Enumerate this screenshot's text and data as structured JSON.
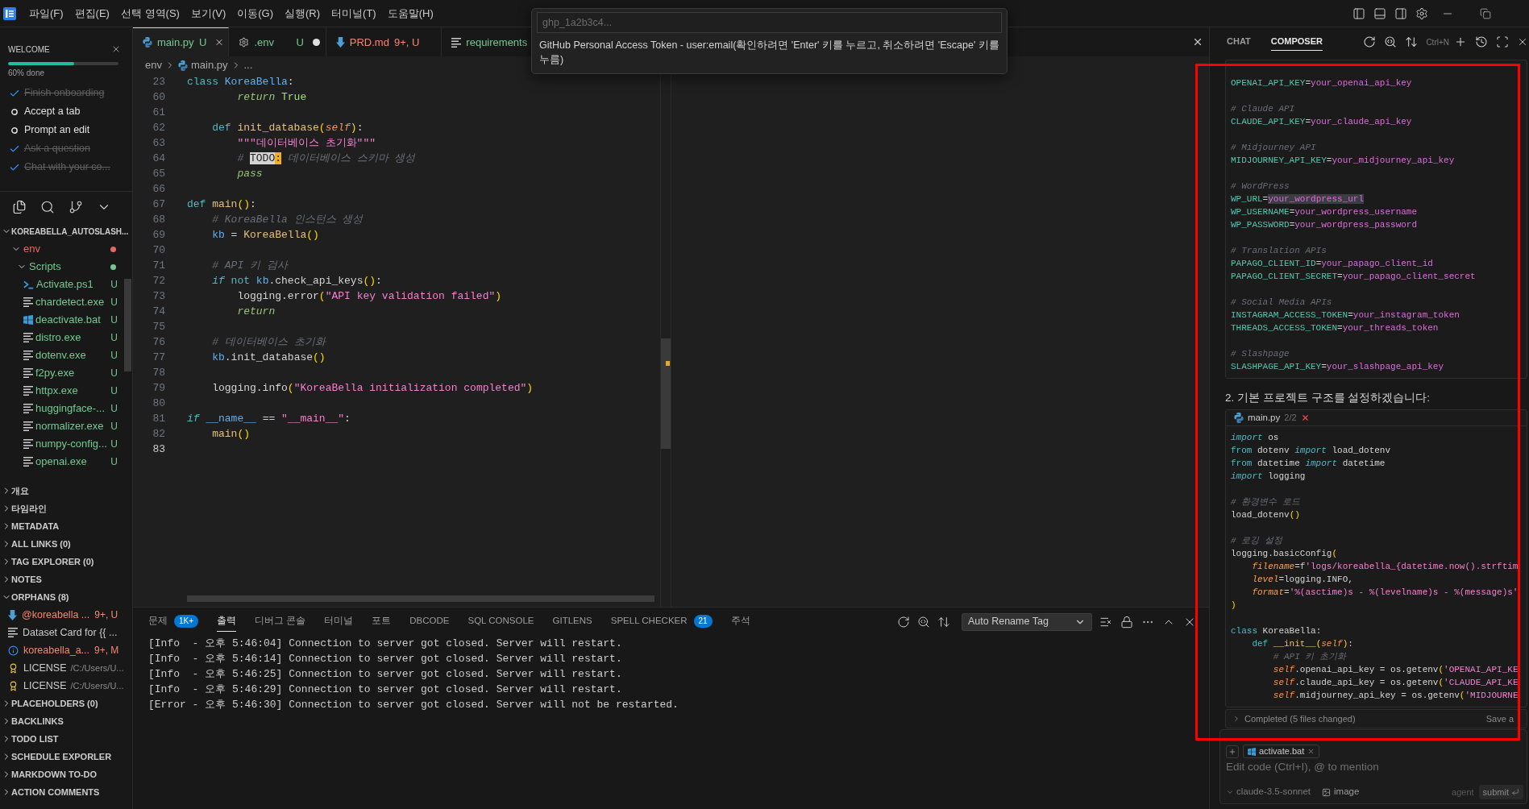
{
  "title_bar": {
    "menus": [
      "파일(F)",
      "편집(E)",
      "선택 영역(S)",
      "보기(V)",
      "이동(G)",
      "실행(R)",
      "터미널(T)",
      "도움말(H)"
    ]
  },
  "sidebar": {
    "welcome": {
      "title": "WELCOME",
      "progress": {
        "level": 0.6,
        "label": "60% done"
      },
      "steps": [
        {
          "label": "Finish onboarding",
          "done": true
        },
        {
          "label": "Accept a tab",
          "done": false
        },
        {
          "label": "Prompt an edit",
          "done": false
        },
        {
          "label": "Ask a question",
          "done": true
        },
        {
          "label": "Chat with your co...",
          "done": true
        }
      ]
    },
    "explorer": {
      "label": "KOREABELLA_AUTOSLASH...",
      "expanded": true,
      "children": [
        {
          "label": "env",
          "kind": "folder",
          "color": "#e8675d",
          "expanded": true,
          "children": [
            {
              "label": "Scripts",
              "kind": "folder",
              "color": "#73c991",
              "expanded": true,
              "children": [
                {
                  "label": "Activate.ps1",
                  "kind": "powershell",
                  "color": "#73c991",
                  "status": "U"
                },
                {
                  "label": "chardetect.exe",
                  "kind": "executable",
                  "color": "#73c991",
                  "status": "U"
                },
                {
                  "label": "deactivate.bat",
                  "kind": "batch",
                  "color": "#73c991",
                  "status": "U"
                },
                {
                  "label": "distro.exe",
                  "kind": "executable",
                  "color": "#73c991",
                  "status": "U"
                },
                {
                  "label": "dotenv.exe",
                  "kind": "executable",
                  "color": "#73c991",
                  "status": "U"
                },
                {
                  "label": "f2py.exe",
                  "kind": "executable",
                  "color": "#73c991",
                  "status": "U"
                },
                {
                  "label": "httpx.exe",
                  "kind": "executable",
                  "color": "#73c991",
                  "status": "U"
                },
                {
                  "label": "huggingface-...",
                  "kind": "executable",
                  "color": "#73c991",
                  "status": "U"
                },
                {
                  "label": "normalizer.exe",
                  "kind": "executable",
                  "color": "#73c991",
                  "status": "U"
                },
                {
                  "label": "numpy-config...",
                  "kind": "executable",
                  "color": "#73c991",
                  "status": "U"
                },
                {
                  "label": "openai.exe",
                  "kind": "executable",
                  "color": "#73c991",
                  "status": "U"
                }
              ]
            }
          ]
        }
      ]
    },
    "sections": [
      {
        "label": "개요",
        "expanded": false
      },
      {
        "label": "타임라인",
        "expanded": false
      },
      {
        "label": "METADATA",
        "expanded": false
      },
      {
        "label": "ALL LINKS (0)",
        "expanded": false
      },
      {
        "label": "TAG EXPLORER (0)",
        "expanded": false
      },
      {
        "label": "NOTES",
        "expanded": false
      },
      {
        "label": "ORPHANS (8)",
        "expanded": true,
        "items": [
          {
            "label": "@koreabella ...",
            "kind": "markdown",
            "color": "#f48771",
            "status": "9+, U"
          },
          {
            "label": "Dataset Card for {{ ...",
            "kind": "text",
            "color": "#cccccc"
          },
          {
            "label": "koreabella_a...",
            "kind": "info",
            "color": "#f48771",
            "status": "9+, M"
          },
          {
            "label": "LICENSE",
            "kind": "license",
            "color": "#cccccc",
            "description": "/C:/Users/U..."
          },
          {
            "label": "LICENSE",
            "kind": "license",
            "color": "#cccccc",
            "description": "/C:/Users/U..."
          }
        ]
      },
      {
        "label": "PLACEHOLDERS (0)",
        "expanded": false
      },
      {
        "label": "BACKLINKS",
        "expanded": false
      },
      {
        "label": "TODO LIST",
        "expanded": false
      },
      {
        "label": "SCHEDULE EXPORLER",
        "expanded": false
      },
      {
        "label": "MARKDOWN TO-DO",
        "expanded": false
      },
      {
        "label": "ACTION COMMENTS",
        "expanded": false
      }
    ]
  },
  "editor": {
    "tabs": [
      {
        "label": "main.py",
        "kind": "python",
        "status": "U",
        "color": "#73c991",
        "selected": true,
        "dirty": false
      },
      {
        "label": ".env",
        "kind": "settings",
        "status": "U",
        "color": "#73c991",
        "selected": false,
        "dirty": true
      },
      {
        "label": "PRD.md",
        "kind": "markdown",
        "status": "9+, U",
        "color": "#f48771",
        "selected": false,
        "dirty": false
      },
      {
        "label": "requirements",
        "kind": "text",
        "color": "#73c991",
        "selected": false
      }
    ],
    "breadcrumb": [
      {
        "label": "env",
        "kind": "folder"
      },
      {
        "label": "main.py",
        "kind": "python"
      },
      {
        "label": "...",
        "kind": "symbol"
      }
    ],
    "lines": [
      {
        "number": "23",
        "current": false,
        "tokens": [
          {
            "text": "class",
            "kind": "keyword"
          },
          {
            "text": " KoreaBella",
            "kind": "type"
          },
          {
            "text": ":",
            "kind": "plain"
          }
        ]
      },
      {
        "number": "60",
        "current": false,
        "tokens": [
          {
            "text": "        return",
            "kind": "control"
          },
          {
            "text": " True",
            "kind": "constant"
          }
        ]
      },
      {
        "number": "61",
        "current": false
      },
      {
        "number": "62",
        "current": false,
        "tokens": [
          {
            "text": "    def",
            "kind": "keyword"
          },
          {
            "text": " init_database",
            "kind": "function"
          },
          {
            "text": "(",
            "kind": "bracket"
          },
          {
            "text": "self",
            "kind": "self"
          },
          {
            "text": ")",
            "kind": "bracket"
          },
          {
            "text": ":",
            "kind": "plain"
          }
        ]
      },
      {
        "number": "63",
        "current": false,
        "tokens": [
          {
            "text": "        \"\"\"데이터베이스 초기화\"\"\"",
            "kind": "string"
          }
        ]
      },
      {
        "number": "64",
        "current": false,
        "tokens": [
          {
            "text": "        # ",
            "kind": "comment"
          },
          {
            "text": "TODO",
            "kind": "todo"
          },
          {
            "text": ":",
            "kind": "todo-colon"
          },
          {
            "text": " 데이터베이스 스키마 생성",
            "kind": "comment"
          }
        ]
      },
      {
        "number": "65",
        "current": false,
        "tokens": [
          {
            "text": "        pass",
            "kind": "control"
          }
        ]
      },
      {
        "number": "66",
        "current": false
      },
      {
        "number": "67",
        "current": false,
        "tokens": [
          {
            "text": "def",
            "kind": "keyword"
          },
          {
            "text": " main",
            "kind": "function"
          },
          {
            "text": "()",
            "kind": "bracket"
          },
          {
            "text": ":",
            "kind": "plain"
          }
        ]
      },
      {
        "number": "68",
        "current": false,
        "tokens": [
          {
            "text": "    # KoreaBella 인스턴스 생성",
            "kind": "comment"
          }
        ]
      },
      {
        "number": "69",
        "current": false,
        "tokens": [
          {
            "text": "    kb",
            "kind": "variable"
          },
          {
            "text": " = ",
            "kind": "plain"
          },
          {
            "text": "KoreaBella",
            "kind": "function"
          },
          {
            "text": "()",
            "kind": "bracket"
          }
        ]
      },
      {
        "number": "70",
        "current": false
      },
      {
        "number": "71",
        "current": false,
        "tokens": [
          {
            "text": "    # API 키 검사",
            "kind": "comment"
          }
        ]
      },
      {
        "number": "72",
        "current": false,
        "tokens": [
          {
            "text": "    if",
            "kind": "keyword-italic"
          },
          {
            "text": " not ",
            "kind": "keyword"
          },
          {
            "text": "kb",
            "kind": "variable"
          },
          {
            "text": ".check_api_keys",
            "kind": "plain"
          },
          {
            "text": "()",
            "kind": "bracket"
          },
          {
            "text": ":",
            "kind": "plain"
          }
        ]
      },
      {
        "number": "73",
        "current": false,
        "tokens": [
          {
            "text": "        logging.error",
            "kind": "plain"
          },
          {
            "text": "(",
            "kind": "bracket"
          },
          {
            "text": "\"API key validation failed\"",
            "kind": "string"
          },
          {
            "text": ")",
            "kind": "bracket"
          }
        ]
      },
      {
        "number": "74",
        "current": false,
        "tokens": [
          {
            "text": "        return",
            "kind": "control"
          }
        ]
      },
      {
        "number": "75",
        "current": false
      },
      {
        "number": "76",
        "current": false,
        "tokens": [
          {
            "text": "    # 데이터베이스 초기화",
            "kind": "comment"
          }
        ]
      },
      {
        "number": "77",
        "current": false,
        "tokens": [
          {
            "text": "    kb",
            "kind": "variable"
          },
          {
            "text": ".init_database",
            "kind": "plain"
          },
          {
            "text": "()",
            "kind": "bracket"
          }
        ]
      },
      {
        "number": "78",
        "current": false
      },
      {
        "number": "79",
        "current": false,
        "tokens": [
          {
            "text": "    logging.info",
            "kind": "plain"
          },
          {
            "text": "(",
            "kind": "bracket"
          },
          {
            "text": "\"KoreaBella initialization completed\"",
            "kind": "string"
          },
          {
            "text": ")",
            "kind": "bracket"
          }
        ]
      },
      {
        "number": "80",
        "current": false
      },
      {
        "number": "81",
        "current": false,
        "tokens": [
          {
            "text": "if",
            "kind": "keyword-italic"
          },
          {
            "text": " __name__",
            "kind": "variable"
          },
          {
            "text": " == ",
            "kind": "plain"
          },
          {
            "text": "\"__main__\"",
            "kind": "string"
          },
          {
            "text": ":",
            "kind": "plain"
          }
        ]
      },
      {
        "number": "82",
        "current": false,
        "tokens": [
          {
            "text": "    main",
            "kind": "function"
          },
          {
            "text": "()",
            "kind": "bracket"
          }
        ]
      },
      {
        "number": "83",
        "current": true
      }
    ]
  },
  "command_input": {
    "placeholder": "ghp_1a2b3c4...",
    "message": "GitHub Personal Access Token - user:email(확인하려면 'Enter' 키를 누르고, 취소하려면 'Escape' 키를 누름)"
  },
  "panel": {
    "tabs": [
      {
        "label": "문제",
        "badge": "1K+",
        "selected": false
      },
      {
        "label": "출력",
        "selected": true
      },
      {
        "label": "디버그 콘솔",
        "selected": false
      },
      {
        "label": "터미널",
        "selected": false
      },
      {
        "label": "포트",
        "selected": false
      },
      {
        "label": "DBCODE",
        "selected": false
      },
      {
        "label": "SQL CONSOLE",
        "selected": false
      },
      {
        "label": "GITLENS",
        "selected": false
      },
      {
        "label": "SPELL CHECKER",
        "badge": "21",
        "selected": false
      },
      {
        "label": "주석",
        "selected": false
      }
    ],
    "output_channel": "Auto Rename Tag",
    "lines": [
      "[Info  - 오후 5:46:04] Connection to server got closed. Server will restart.",
      "[Info  - 오후 5:46:14] Connection to server got closed. Server will restart.",
      "[Info  - 오후 5:46:25] Connection to server got closed. Server will restart.",
      "[Info  - 오후 5:46:29] Connection to server got closed. Server will restart.",
      "[Error - 오후 5:46:30] Connection to server got closed. Server will not be restarted."
    ]
  },
  "chat": {
    "tabs": [
      {
        "label": "CHAT",
        "selected": false
      },
      {
        "label": "COMPOSER",
        "selected": true
      }
    ],
    "shortcut": "Ctrl+N",
    "blocks": [
      {
        "kind": "code",
        "groups": [
          [
            [
              {
                "text": "OPENAI_API_KEY",
                "kind": "env-key"
              },
              {
                "text": "=",
                "kind": "plain"
              },
              {
                "text": "your_openai_api_key",
                "kind": "env-value"
              }
            ]
          ],
          [
            [
              {
                "text": "# Claude API",
                "kind": "comment"
              }
            ],
            [
              {
                "text": "CLAUDE_API_KEY",
                "kind": "env-key"
              },
              {
                "text": "=",
                "kind": "plain"
              },
              {
                "text": "your_claude_api_key",
                "kind": "env-value"
              }
            ]
          ],
          [
            [
              {
                "text": "# Midjourney API",
                "kind": "comment"
              }
            ],
            [
              {
                "text": "MIDJOURNEY_API_KEY",
                "kind": "env-key"
              },
              {
                "text": "=",
                "kind": "plain"
              },
              {
                "text": "your_midjourney_api_key",
                "kind": "env-value"
              }
            ]
          ],
          [
            [
              {
                "text": "# WordPress",
                "kind": "comment"
              }
            ],
            [
              {
                "text": "WP_URL",
                "kind": "env-key"
              },
              {
                "text": "=",
                "kind": "plain"
              },
              {
                "text": "your_wordpress_url",
                "kind": "env-value-selected"
              }
            ],
            [
              {
                "text": "WP_USERNAME",
                "kind": "env-key"
              },
              {
                "text": "=",
                "kind": "plain"
              },
              {
                "text": "your_wordpress_username",
                "kind": "env-value"
              }
            ],
            [
              {
                "text": "WP_PASSWORD",
                "kind": "env-key"
              },
              {
                "text": "=",
                "kind": "plain"
              },
              {
                "text": "your_wordpress_password",
                "kind": "env-value"
              }
            ]
          ],
          [
            [
              {
                "text": "# Translation APIs",
                "kind": "comment"
              }
            ],
            [
              {
                "text": "PAPAGO_CLIENT_ID",
                "kind": "env-key"
              },
              {
                "text": "=",
                "kind": "plain"
              },
              {
                "text": "your_papago_client_id",
                "kind": "env-value"
              }
            ],
            [
              {
                "text": "PAPAGO_CLIENT_SECRET",
                "kind": "env-key"
              },
              {
                "text": "=",
                "kind": "plain"
              },
              {
                "text": "your_papago_client_secret",
                "kind": "env-value"
              }
            ]
          ],
          [
            [
              {
                "text": "# Social Media APIs",
                "kind": "comment"
              }
            ],
            [
              {
                "text": "INSTAGRAM_ACCESS_TOKEN",
                "kind": "env-key"
              },
              {
                "text": "=",
                "kind": "plain"
              },
              {
                "text": "your_instagram_token",
                "kind": "env-value"
              }
            ],
            [
              {
                "text": "THREADS_ACCESS_TOKEN",
                "kind": "env-key"
              },
              {
                "text": "=",
                "kind": "plain"
              },
              {
                "text": "your_threads_token",
                "kind": "env-value"
              }
            ]
          ],
          [
            [
              {
                "text": "# Slashpage",
                "kind": "comment"
              }
            ],
            [
              {
                "text": "SLASHPAGE_API_KEY",
                "kind": "env-key"
              },
              {
                "text": "=",
                "kind": "plain"
              },
              {
                "text": "your_slashpage_api_key",
                "kind": "env-value"
              }
            ]
          ]
        ]
      },
      {
        "kind": "text",
        "text": "2. 기본 프로젝트 구조를 설정하겠습니다:"
      },
      {
        "kind": "code",
        "file": "main.py",
        "count": "2/2",
        "groups": [
          [
            [
              {
                "text": "import",
                "kind": "keyword-italic"
              },
              {
                "text": " os",
                "kind": "plain"
              }
            ],
            [
              {
                "text": "from",
                "kind": "keyword"
              },
              {
                "text": " dotenv ",
                "kind": "plain"
              },
              {
                "text": "import",
                "kind": "keyword-italic"
              },
              {
                "text": " load_dotenv",
                "kind": "plain"
              }
            ],
            [
              {
                "text": "from",
                "kind": "keyword"
              },
              {
                "text": " datetime ",
                "kind": "plain"
              },
              {
                "text": "import",
                "kind": "keyword-italic"
              },
              {
                "text": " datetime",
                "kind": "plain"
              }
            ],
            [
              {
                "text": "import",
                "kind": "keyword-italic"
              },
              {
                "text": " logging",
                "kind": "plain"
              }
            ]
          ],
          [
            [
              {
                "text": "# 환경변수 로드",
                "kind": "comment"
              }
            ],
            [
              {
                "text": "load_dotenv",
                "kind": "plain"
              },
              {
                "text": "()",
                "kind": "bracket"
              }
            ]
          ],
          [
            [
              {
                "text": "# 로깅 설정",
                "kind": "comment"
              }
            ],
            [
              {
                "text": "logging.basicConfig",
                "kind": "plain"
              },
              {
                "text": "(",
                "kind": "bracket"
              }
            ],
            [
              {
                "text": "    filename",
                "kind": "parameter"
              },
              {
                "text": "=f",
                "kind": "plain"
              },
              {
                "text": "'logs/koreabella_{datetime.now().strftim",
                "kind": "string"
              }
            ],
            [
              {
                "text": "    level",
                "kind": "parameter"
              },
              {
                "text": "=logging.INFO,",
                "kind": "plain"
              }
            ],
            [
              {
                "text": "    format",
                "kind": "parameter"
              },
              {
                "text": "=",
                "kind": "plain"
              },
              {
                "text": "'%(asctime)s - %(levelname)s - %(message)s'",
                "kind": "string"
              }
            ],
            [
              {
                "text": ")",
                "kind": "bracket"
              }
            ]
          ],
          [
            [
              {
                "text": "class",
                "kind": "keyword"
              },
              {
                "text": " KoreaBella:",
                "kind": "plain"
              }
            ],
            [
              {
                "text": "    def",
                "kind": "keyword"
              },
              {
                "text": " __init__",
                "kind": "function"
              },
              {
                "text": "(",
                "kind": "bracket"
              },
              {
                "text": "self",
                "kind": "self"
              },
              {
                "text": ")",
                "kind": "bracket"
              },
              {
                "text": ":",
                "kind": "plain"
              }
            ],
            [
              {
                "text": "        # API 키 초기화",
                "kind": "comment"
              }
            ],
            [
              {
                "text": "        self",
                "kind": "self"
              },
              {
                "text": ".openai_api_key = os.getenv",
                "kind": "plain"
              },
              {
                "text": "(",
                "kind": "bracket"
              },
              {
                "text": "'OPENAI_API_KE",
                "kind": "string"
              }
            ],
            [
              {
                "text": "        self",
                "kind": "self"
              },
              {
                "text": ".claude_api_key = os.getenv",
                "kind": "plain"
              },
              {
                "text": "(",
                "kind": "bracket"
              },
              {
                "text": "'CLAUDE_API_KE",
                "kind": "string"
              }
            ],
            [
              {
                "text": "        self",
                "kind": "self"
              },
              {
                "text": ".midjourney_api_key = os.getenv",
                "kind": "plain"
              },
              {
                "text": "(",
                "kind": "bracket"
              },
              {
                "text": "'MIDJOURNE",
                "kind": "string"
              }
            ]
          ]
        ]
      }
    ],
    "status": {
      "label": "Completed (5 files changed)",
      "action": "Save a"
    },
    "composer": {
      "attachment": "activate.bat",
      "placeholder": "Edit code (Ctrl+I), @ to mention",
      "model": "claude-3.5-sonnet",
      "image_label": "image",
      "mode": "agent",
      "submit": "submit"
    }
  }
}
